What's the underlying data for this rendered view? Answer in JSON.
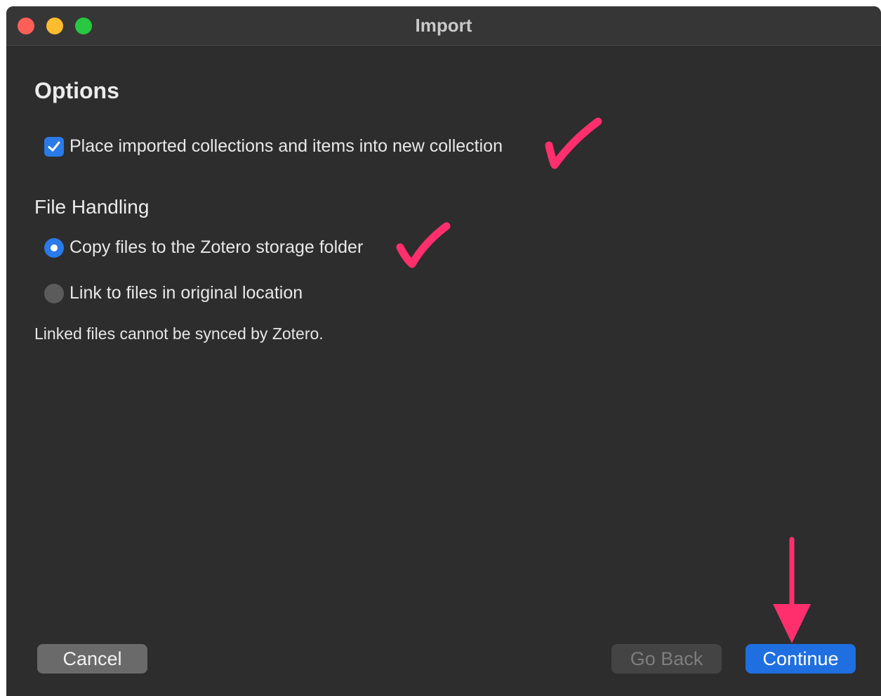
{
  "window": {
    "title": "Import"
  },
  "options": {
    "heading": "Options",
    "new_collection_checkbox": {
      "label": "Place imported collections and items into new collection",
      "checked": true
    }
  },
  "file_handling": {
    "heading": "File Handling",
    "radios": [
      {
        "label": "Copy files to the Zotero storage folder",
        "selected": true
      },
      {
        "label": "Link to files in original location",
        "selected": false
      }
    ],
    "note": "Linked files cannot be synced by Zotero."
  },
  "buttons": {
    "cancel": "Cancel",
    "go_back": "Go Back",
    "continue": "Continue"
  },
  "colors": {
    "accent": "#2a7ae8",
    "annotation": "#ff2f6e",
    "window_bg": "#2d2d2d"
  }
}
